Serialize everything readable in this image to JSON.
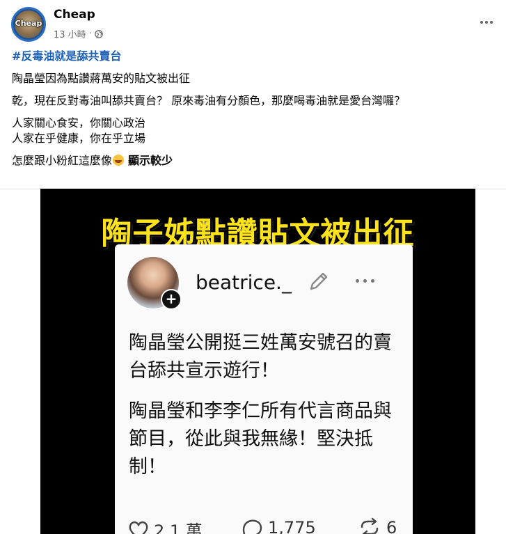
{
  "post": {
    "author": "Cheap",
    "avatar_label": "Cheap",
    "time": "13 小時",
    "separator": "·",
    "privacy_icon": "globe-icon",
    "menu_icon": "more-horizontal-icon"
  },
  "content": {
    "hashtag": "#反毒油就是舔共賣台",
    "line1": "陶晶瑩因為點讚蔣萬安的貼文被出征",
    "line2": "乾，現在反對毒油叫舔共賣台？ 原來毒油有分顏色，那麼喝毒油就是愛台灣囉？",
    "line3": "人家關心食安，你關心政治",
    "line4": "人家在乎健康，你在乎立場",
    "line5": "怎麼跟小粉紅這麼像",
    "emoji": "grinning-sweat-emoji",
    "see_more": "顯示較少"
  },
  "image": {
    "banner": "陶子姊點讚貼文被出征",
    "username": "beatrice._",
    "post_para1": "陶晶瑩公開挺三姓萬安號召的賣台舔共宣示遊行！",
    "post_para2": "陶晶瑩和李李仁所有代言商品與節目，從此與我無緣！堅決抵制！",
    "likes": "2.1 萬",
    "comments": "1,775",
    "reposts": "6",
    "colors": {
      "banner": "#ffe31a",
      "background": "#000000"
    }
  }
}
